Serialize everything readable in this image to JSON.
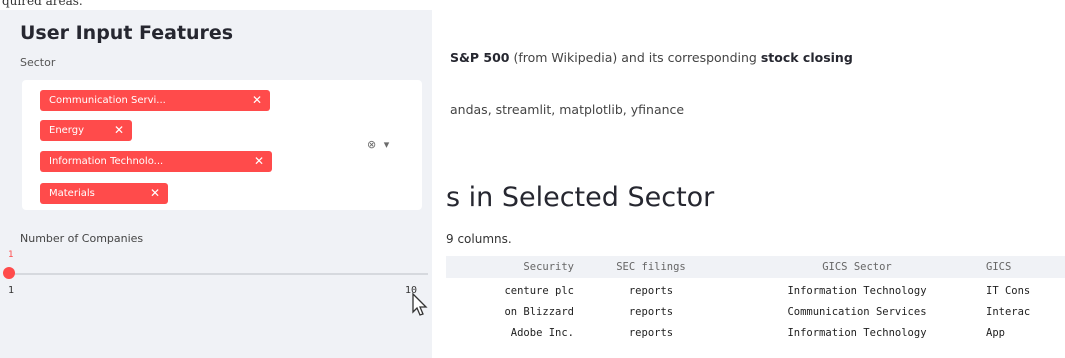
{
  "top_clip_text": "quired areas.",
  "sidebar": {
    "title": "User Input Features",
    "sector_label": "Sector",
    "selected_sectors": [
      {
        "label": "Communication Servi..."
      },
      {
        "label": "Energy"
      },
      {
        "label": "Information Technolo..."
      },
      {
        "label": "Materials"
      }
    ],
    "chip_remove_glyph": "✕",
    "clear_glyph": "⊗",
    "dropdown_glyph": "▾",
    "num_companies_label": "Number of Companies",
    "slider": {
      "value": "1",
      "min": "1",
      "max": "10"
    }
  },
  "main": {
    "desc1_a": "S&P 500",
    "desc1_b": " (from Wikipedia) and its corresponding ",
    "desc1_c": "stock closing",
    "desc2": "andas, streamlit, matplotlib, yfinance",
    "section_title": "s in Selected Sector",
    "dims_text": "9 columns.",
    "table": {
      "headers": [
        "Security",
        "SEC filings",
        "GICS Sector",
        "GICS"
      ],
      "rows": [
        [
          "centure plc",
          "reports",
          "Information Technology",
          "IT Cons"
        ],
        [
          "on Blizzard",
          "reports",
          "Communication Services",
          "Interac"
        ],
        [
          "Adobe Inc.",
          "reports",
          "Information Technology",
          "App"
        ],
        [
          "",
          "",
          "",
          ""
        ]
      ]
    }
  },
  "colors": {
    "accent": "#ff4b4b",
    "sidebar_bg": "#f0f2f6",
    "text": "#262730"
  }
}
